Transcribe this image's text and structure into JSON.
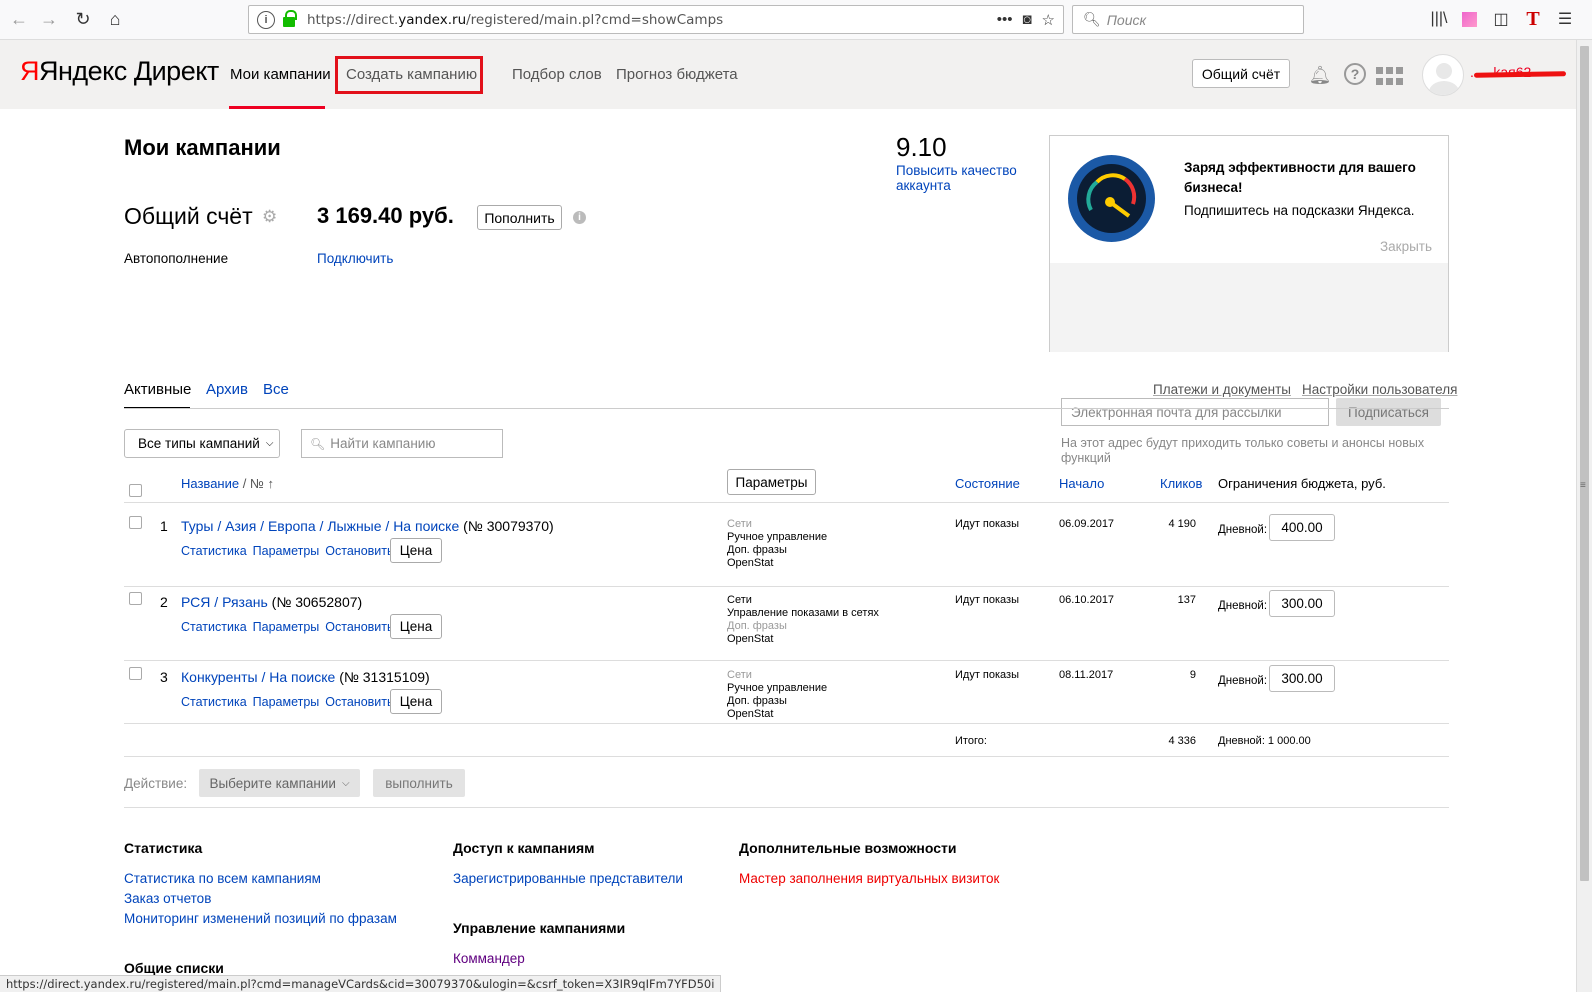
{
  "browser": {
    "url_prefix": "https://direct.",
    "url_domain": "yandex.ru",
    "url_path": "/registered/main.pl?cmd=showCamps",
    "search_placeholder": "Поиск",
    "status_url": "https://direct.yandex.ru/registered/main.pl?cmd=manageVCards&cid=30079370&ulogin=&csrf_token=X3IR9qIFm7YFD50i"
  },
  "header": {
    "logo_ya": "Яндекс",
    "logo_direct": "Директ",
    "nav": {
      "my_campaigns": "Мои кампании",
      "create_campaign": "Создать кампанию",
      "word_selection": "Подбор слов",
      "budget_forecast": "Прогноз бюджета"
    },
    "account_button": "Общий счёт",
    "username": "......kaя62"
  },
  "summary": {
    "page_title": "Мои кампании",
    "account_label": "Общий счёт",
    "balance": "3 169.40 руб.",
    "topup": "Пополнить",
    "autofill_label": "Автопополнение",
    "autofill_link": "Подключить",
    "quality_score": "9.10",
    "quality_link": "Повысить качество аккаунта"
  },
  "promo": {
    "title": "Заряд эффективности для вашего бизнеса!",
    "text": "Подпишитесь на подсказки Яндекса.",
    "close": "Закрыть",
    "email_placeholder": "Электронная почта для рассылки",
    "subscribe": "Подписаться",
    "note": "На этот адрес будут приходить только советы и анонсы новых функций"
  },
  "tabs": {
    "active": "Активные",
    "archive": "Архив",
    "all": "Все",
    "payments": "Платежи и документы",
    "user_settings": "Настройки пользователя"
  },
  "filters": {
    "types": "Все типы кампаний",
    "search_placeholder": "Найти кампанию"
  },
  "table": {
    "col_name": "Название",
    "col_num": "/ № ↑",
    "params_button": "Параметры",
    "col_state": "Состояние",
    "col_start": "Начало",
    "col_clicks": "Кликов",
    "col_limit": "Ограничения бюджета, руб.",
    "rows": [
      {
        "num": "1",
        "name": "Туры / Азия / Европа / Лыжные / На поиске",
        "id": "(№ 30079370)",
        "stat": "Статистика",
        "params": "Параметры",
        "stop": "Остановить",
        "price": "Цена",
        "flag1": "Сети",
        "flag2": "Ручное управление",
        "flag3": "Доп. фразы",
        "flag4": "OpenStat",
        "state": "Идут показы",
        "start": "06.09.2017",
        "clicks": "4 190",
        "limit_label": "Дневной:",
        "limit": "400.00"
      },
      {
        "num": "2",
        "name": "РСЯ / Рязань",
        "id": "(№ 30652807)",
        "stat": "Статистика",
        "params": "Параметры",
        "stop": "Остановить",
        "price": "Цена",
        "flag1": "Сети",
        "flag2": "Управление показами в сетях",
        "flag3": "Доп. фразы",
        "flag4": "OpenStat",
        "state": "Идут показы",
        "start": "06.10.2017",
        "clicks": "137",
        "limit_label": "Дневной:",
        "limit": "300.00"
      },
      {
        "num": "3",
        "name": "Конкуренты / На поиске",
        "id": "(№ 31315109)",
        "stat": "Статистика",
        "params": "Параметры",
        "stop": "Остановить",
        "price": "Цена",
        "flag1": "Сети",
        "flag2": "Ручное управление",
        "flag3": "Доп. фразы",
        "flag4": "OpenStat",
        "state": "Идут показы",
        "start": "08.11.2017",
        "clicks": "9",
        "limit_label": "Дневной:",
        "limit": "300.00"
      }
    ],
    "total_label": "Итого:",
    "total_clicks": "4 336",
    "total_budget": "Дневной: 1 000.00"
  },
  "actions": {
    "label": "Действие:",
    "choose": "Выберите кампании",
    "execute": "выполнить"
  },
  "footer": {
    "stats_title": "Статистика",
    "stats_all": "Статистика по всем кампаниям",
    "reports": "Заказ отчетов",
    "monitoring": "Мониторинг изменений позиций по фразам",
    "access_title": "Доступ к кампаниям",
    "representatives": "Зарегистрированные представители",
    "manage_title": "Управление кампаниями",
    "commander": "Коммандер",
    "extra_title": "Дополнительные возможности",
    "wizard": "Мастер заполнения виртуальных визиток",
    "lists_title": "Общие списки"
  },
  "colors": {
    "link": "#0044bb",
    "accent_red": "#e2101a",
    "header_bg": "#f2f1f0"
  }
}
